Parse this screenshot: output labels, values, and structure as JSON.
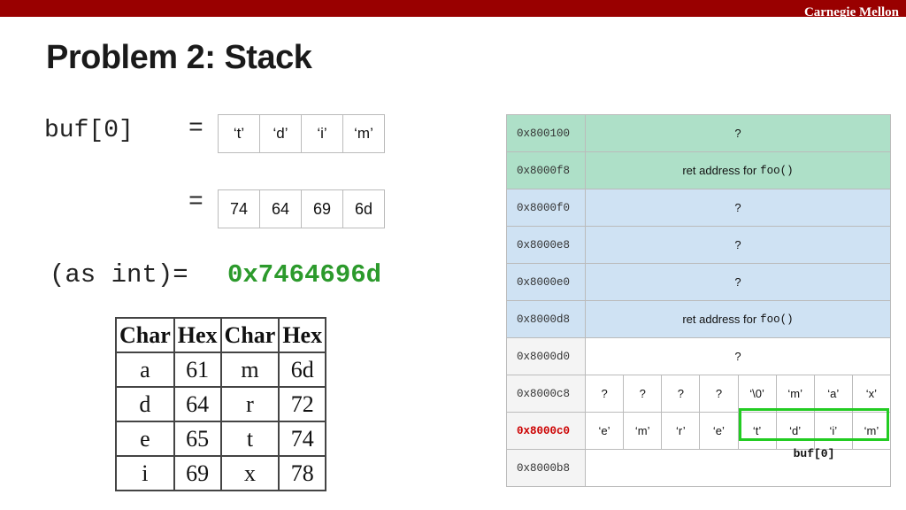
{
  "header": {
    "org": "Carnegie Mellon"
  },
  "title": "Problem 2: Stack",
  "buf_label": "buf[0]",
  "equals": "=",
  "chars": [
    "‘t’",
    "‘d’",
    "‘i’",
    "‘m’"
  ],
  "hexes": [
    "74",
    "64",
    "69",
    "6d"
  ],
  "asint": {
    "label": "(as int)=",
    "value": "0x7464696d"
  },
  "hex_table": {
    "headers": [
      "Char",
      "Hex",
      "Char",
      "Hex"
    ],
    "rows": [
      [
        "a",
        "61",
        "m",
        "6d"
      ],
      [
        "d",
        "64",
        "r",
        "72"
      ],
      [
        "e",
        "65",
        "t",
        "74"
      ],
      [
        "i",
        "69",
        "x",
        "78"
      ]
    ]
  },
  "stack": {
    "rows": [
      {
        "addr": "0x800100",
        "text": "?"
      },
      {
        "addr": "0x8000f8",
        "text": "ret address for",
        "code": "foo()"
      },
      {
        "addr": "0x8000f0",
        "text": "?"
      },
      {
        "addr": "0x8000e8",
        "text": "?"
      },
      {
        "addr": "0x8000e0",
        "text": "?"
      },
      {
        "addr": "0x8000d8",
        "text": "ret address for",
        "code": "foo()"
      },
      {
        "addr": "0x8000d0",
        "text": "?"
      },
      {
        "addr": "0x8000c8",
        "bytes": [
          "?",
          "?",
          "?",
          "?",
          "‘\\0’",
          "‘m’",
          "‘a’",
          "‘x’"
        ]
      },
      {
        "addr": "0x8000c0",
        "bytes": [
          "‘e’",
          "‘m’",
          "‘r’",
          "‘e’",
          "‘t’",
          "‘d’",
          "‘i’",
          "‘m’"
        ]
      },
      {
        "addr": "0x8000b8"
      }
    ],
    "highlight_label": "buf[0]"
  },
  "colors": {
    "header": "#990000",
    "accent_green": "#2c9a2c",
    "highlight": "#22cc22",
    "ret_region": "#aee0c8",
    "frame_region": "#cfe2f3",
    "current_addr": "#cc0000"
  }
}
